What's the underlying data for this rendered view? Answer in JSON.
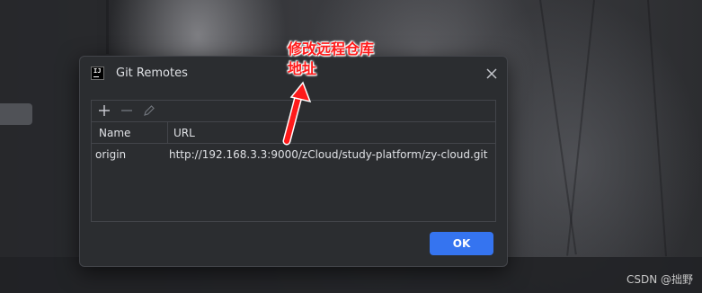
{
  "dialog": {
    "title": "Git Remotes",
    "close_icon": "close-icon",
    "app_icon": "intellij-idea-icon",
    "toolbar": {
      "add_icon": "plus-icon",
      "remove_icon": "minus-icon",
      "edit_icon": "pencil-icon"
    },
    "table": {
      "columns": [
        "Name",
        "URL"
      ],
      "rows": [
        {
          "name": "origin",
          "url": "http://192.168.3.3:9000/zCloud/study-platform/zy-cloud.git"
        }
      ]
    },
    "ok_label": "OK"
  },
  "annotation": {
    "line1": "修改远程仓库",
    "line2": "地址",
    "color": "#ff1a1a"
  },
  "watermark": "CSDN @拙野",
  "colors": {
    "dialog_bg": "#2b2d30",
    "border": "#43454a",
    "ok_button": "#3574f0",
    "text": "#dfe1e5"
  }
}
